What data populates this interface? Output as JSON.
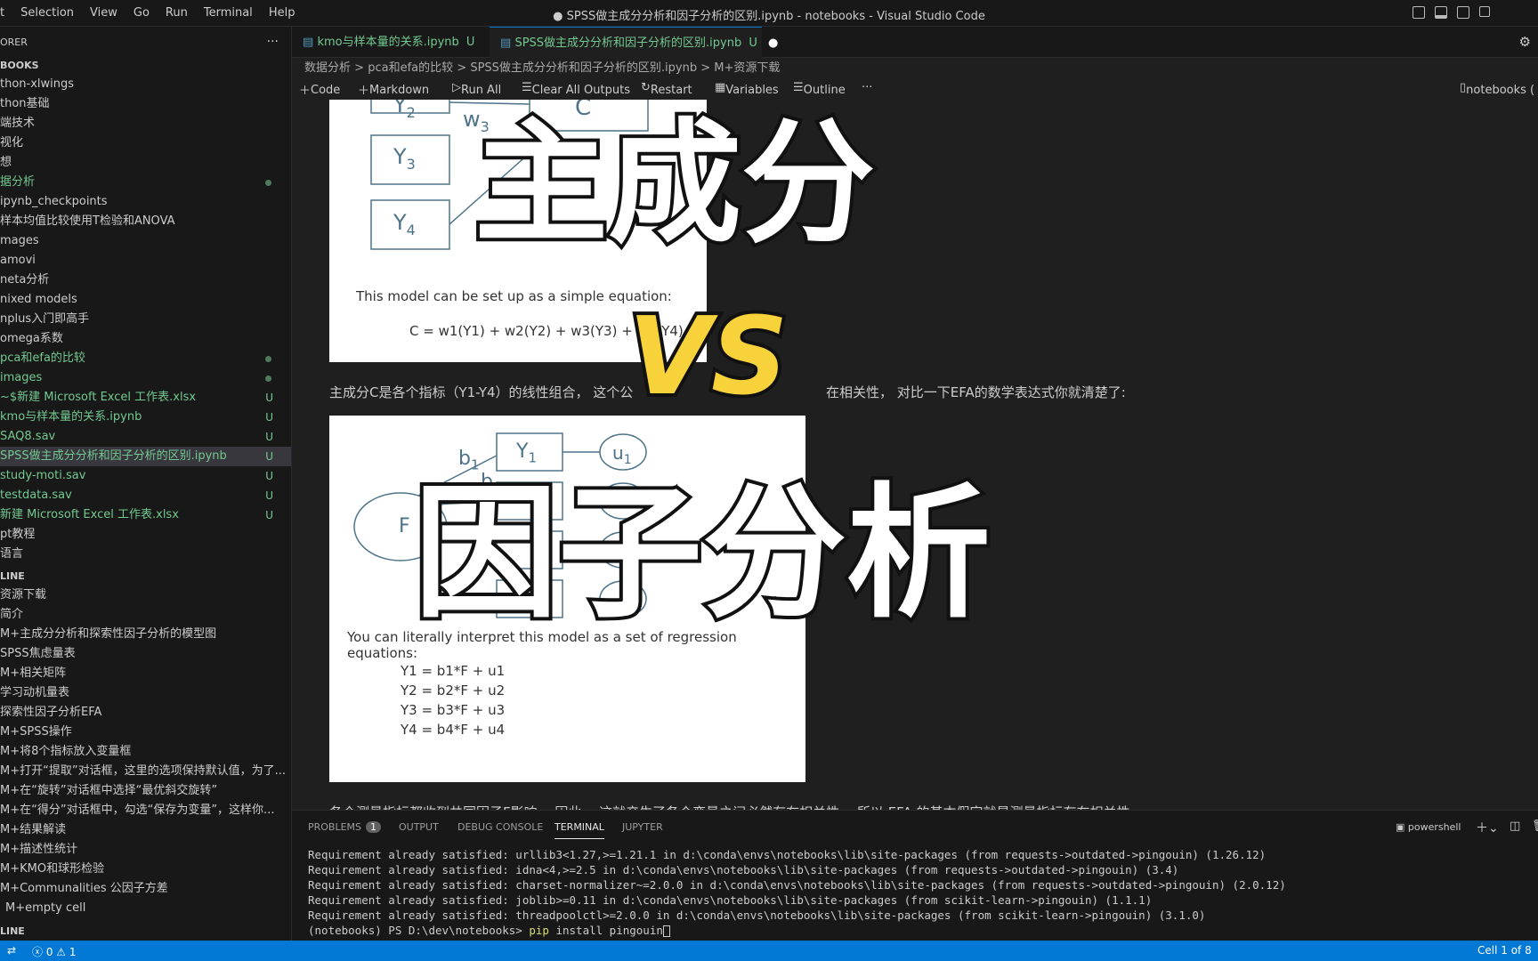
{
  "window": {
    "title": "● SPSS做主成分分析和因子分析的区别.ipynb - notebooks - Visual Studio Code"
  },
  "menu": [
    "t",
    "Selection",
    "View",
    "Go",
    "Run",
    "Terminal",
    "Help"
  ],
  "sidebar": {
    "explorer_label": "ORER",
    "section_label": "BOOKS",
    "files": [
      {
        "label": "thon-xlwings",
        "badge": "",
        "green": false
      },
      {
        "label": "thon基础",
        "badge": "",
        "green": false
      },
      {
        "label": "端技术",
        "badge": "",
        "green": false
      },
      {
        "label": "视化",
        "badge": "",
        "green": false
      },
      {
        "label": "想",
        "badge": "",
        "green": false
      },
      {
        "label": "据分析",
        "badge": "dot",
        "green": true
      },
      {
        "label": "ipynb_checkpoints",
        "badge": "",
        "green": false
      },
      {
        "label": "样本均值比较使用T检验和ANOVA",
        "badge": "",
        "green": false
      },
      {
        "label": "mages",
        "badge": "",
        "green": false
      },
      {
        "label": "amovi",
        "badge": "",
        "green": false
      },
      {
        "label": "neta分析",
        "badge": "",
        "green": false
      },
      {
        "label": "nixed models",
        "badge": "",
        "green": false
      },
      {
        "label": "nplus入门即高手",
        "badge": "",
        "green": false
      },
      {
        "label": "omega系数",
        "badge": "",
        "green": false
      },
      {
        "label": "pca和efa的比较",
        "badge": "dot",
        "green": true
      },
      {
        "label": "images",
        "badge": "dot",
        "green": true
      },
      {
        "label": "~$新建 Microsoft Excel 工作表.xlsx",
        "badge": "U",
        "green": true
      },
      {
        "label": "kmo与样本量的关系.ipynb",
        "badge": "U",
        "green": true
      },
      {
        "label": "SAQ8.sav",
        "badge": "U",
        "green": true
      },
      {
        "label": "SPSS做主成分分析和因子分析的区别.ipynb",
        "badge": "U",
        "green": true,
        "selected": true
      },
      {
        "label": "study-moti.sav",
        "badge": "U",
        "green": true
      },
      {
        "label": "testdata.sav",
        "badge": "U",
        "green": true
      },
      {
        "label": "新建 Microsoft Excel 工作表.xlsx",
        "badge": "U",
        "green": true
      },
      {
        "label": "pt教程",
        "badge": "",
        "green": false
      },
      {
        "label": "语言",
        "badge": "",
        "green": false
      }
    ],
    "outline_label": "LINE",
    "outline": [
      "资源下载",
      "简介",
      "M+主成分分析和探索性因子分析的模型图",
      "SPSS焦虑量表",
      "M+相关矩阵",
      "学习动机量表",
      "探索性因子分析EFA",
      "M+SPSS操作",
      "M+将8个指标放入变量框",
      "M+打开“提取”对话框，这里的选项保持默认值，为了...",
      "M+在“旋转”对话框中选择“最优斜交旋转”",
      "M+在“得分”对话框中，勾选“保存为变量”，这样你...",
      "M+结果解读",
      "M+描述性统计",
      "M+KMO和球形检验",
      "M+Communalities 公因子方差",
      "M+empty cell"
    ],
    "timeline_label": "LINE"
  },
  "tabs": [
    {
      "label": "kmo与样本量的关系.ipynb",
      "badge": "U"
    },
    {
      "label": "SPSS做主成分分析和因子分析的区别.ipynb",
      "badge": "U"
    }
  ],
  "breadcrumb": [
    "数据分析",
    ">",
    "pca和efa的比较",
    ">",
    "SPSS做主成分分析和因子分析的区别.ipynb",
    ">",
    "M+资源下载"
  ],
  "toolbar": {
    "code": "Code",
    "markdown": "Markdown",
    "run_all": "Run All",
    "clear": "Clear All Outputs",
    "restart": "Restart",
    "variables": "Variables",
    "outline": "Outline",
    "more": "···",
    "kernel": "notebooks ("
  },
  "cell1": {
    "y2": "Y",
    "y2sub": "2",
    "w3": "w",
    "w3sub": "3",
    "c": "C",
    "y3": "Y",
    "y3sub": "3",
    "y4": "Y",
    "y4sub": "4",
    "caption": "This model can be set up as a simple equation:",
    "equation": "C = w1(Y1) + w2(Y2) + w3(Y3) + w4(Y4)"
  },
  "md1": {
    "left": "主成分C是各个指标（Y1-Y4）的线性组合， 这个公",
    "right": "在相关性， 对比一下EFA的数学表达式你就清楚了:"
  },
  "cell2": {
    "b1": "b",
    "b1sub": "1",
    "b2": "b",
    "b2sub": "2",
    "y1": "Y",
    "y1sub": "1",
    "u1": "u",
    "u1sub": "1",
    "f": "F",
    "caption": "You can literally interpret this model as a set of regression equations:",
    "eq": [
      "Y1 = b1*F + u1",
      "Y2 = b2*F + u2",
      "Y3 = b3*F + u3",
      "Y4 = b4*F + u4"
    ]
  },
  "md2": "各个测量指标都收到共同因子F影响， 因此， 这就产生了各个变量之间必然存在相关性， 所以 EFA 的基本假定就是测量指标存在相关性",
  "overlay": {
    "line1": "主成分",
    "line2": "VS",
    "line3": "因子分析"
  },
  "panel": {
    "tabs": [
      "PROBLEMS",
      "1",
      "OUTPUT",
      "DEBUG CONSOLE",
      "TERMINAL",
      "JUPYTER"
    ],
    "shell": "powershell",
    "lines": [
      "Requirement already satisfied: urllib3<1.27,>=1.21.1 in d:\\conda\\envs\\notebooks\\lib\\site-packages (from requests->outdated->pingouin) (1.26.12)",
      "Requirement already satisfied: idna<4,>=2.5 in d:\\conda\\envs\\notebooks\\lib\\site-packages (from requests->outdated->pingouin) (3.4)",
      "Requirement already satisfied: charset-normalizer~=2.0.0 in d:\\conda\\envs\\notebooks\\lib\\site-packages (from requests->outdated->pingouin) (2.0.12)",
      "Requirement already satisfied: joblib>=0.11 in d:\\conda\\envs\\notebooks\\lib\\site-packages (from scikit-learn->pingouin) (1.1.1)",
      "Requirement already satisfied: threadpoolctl>=2.0.0 in d:\\conda\\envs\\notebooks\\lib\\site-packages (from scikit-learn->pingouin) (3.1.0)"
    ],
    "prompt": "(notebooks) PS D:\\dev\\notebooks> ",
    "cmd": "pip",
    "args": " install  pingouin"
  },
  "status": {
    "errors": "0",
    "warnings": "1",
    "cell": "Cell 1 of 8"
  },
  "colors": {
    "accent": "#0078d4",
    "overlay_yellow": "#f7d23a",
    "git_green": "#73c991"
  }
}
